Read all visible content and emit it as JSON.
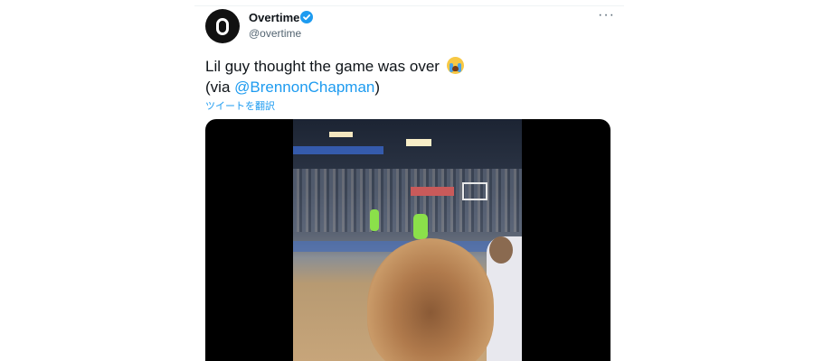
{
  "tweet": {
    "display_name": "Overtime",
    "handle": "@overtime",
    "text_line1": "Lil guy thought the game was over",
    "text_via_prefix": "(via ",
    "mention": "@BrennonChapman",
    "text_via_suffix": ")",
    "translate_label": "ツイートを翻訳",
    "more_label": "···"
  },
  "icons": {
    "avatar": "overtime-logo",
    "verified": "verified-badge-icon",
    "emoji": "loudly-crying-face-emoji",
    "more": "more-options-icon"
  },
  "colors": {
    "accent": "#1d9bf0",
    "text": "#0f1419",
    "secondary": "#536471"
  }
}
